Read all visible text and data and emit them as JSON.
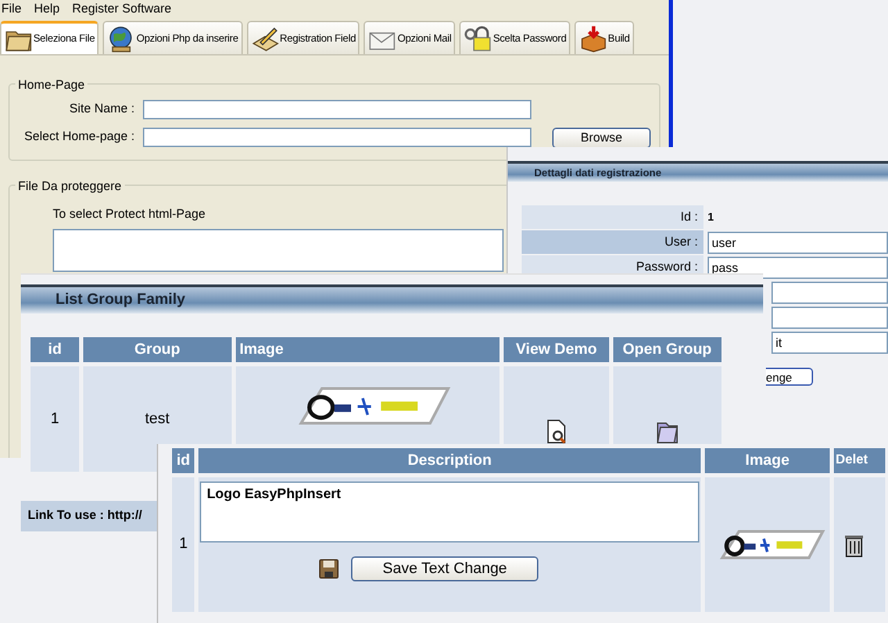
{
  "menu": [
    "File",
    "Help",
    "Register Software"
  ],
  "tabs": [
    {
      "label": "Seleziona  File",
      "selected": true
    },
    {
      "label": "Opzioni Php da inserire",
      "selected": false
    },
    {
      "label": "Registration Field",
      "selected": false
    },
    {
      "label": "Opzioni Mail",
      "selected": false
    },
    {
      "label": "Scelta Password",
      "selected": false
    },
    {
      "label": "Build",
      "selected": false
    }
  ],
  "home_page": {
    "legend": "Home-Page",
    "fields": [
      {
        "label": "Site Name :"
      },
      {
        "label": "Select  Home-page :"
      }
    ],
    "browse_button": "Browse"
  },
  "protect": {
    "legend": "File Da proteggere",
    "label": "To select Protect html-Page"
  },
  "registration": {
    "title": "Dettagli dati registrazione",
    "rows": [
      {
        "kind": "text",
        "label": "Id :",
        "value": "1"
      },
      {
        "kind": "input",
        "label": "User :",
        "value": "user"
      },
      {
        "kind": "input",
        "label": "Password :",
        "value": "pass"
      },
      {
        "kind": "input"
      },
      {
        "kind": "input"
      },
      {
        "kind": "input",
        "value": "it"
      }
    ],
    "button": "enge"
  },
  "group_family": {
    "title": "List Group Family",
    "columns": [
      "id",
      "Group",
      "Image",
      "View Demo",
      "Open Group"
    ],
    "rows": [
      {
        "id": "1",
        "group": "test"
      }
    ],
    "link_label": "Link To use : http://"
  },
  "descriptions": {
    "columns": [
      "id",
      "Description",
      "Image",
      "Delet"
    ],
    "rows": [
      {
        "id": "1",
        "description": "Logo EasyPhpInsert",
        "button": "Save Text Change"
      }
    ]
  }
}
